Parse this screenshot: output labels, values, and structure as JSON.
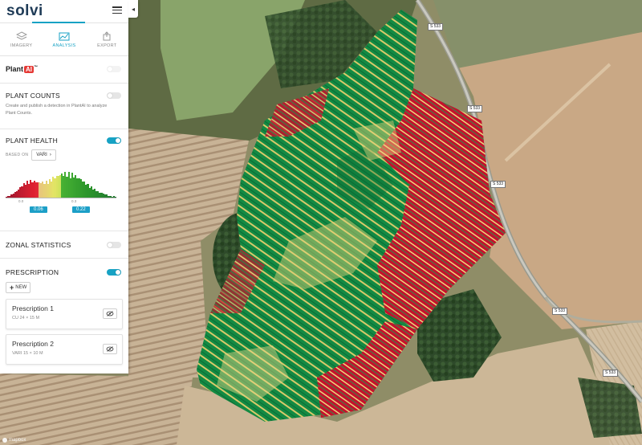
{
  "app": {
    "logo_text": "solvi",
    "accent_color": "#17a2c4"
  },
  "tabs": [
    {
      "label": "IMAGERY",
      "icon": "layers-icon",
      "active": false
    },
    {
      "label": "ANALYSIS",
      "icon": "analysis-chart-icon",
      "active": true
    },
    {
      "label": "EXPORT",
      "icon": "export-icon",
      "active": false
    }
  ],
  "plantai": {
    "title": "Plant",
    "badge": "AI",
    "trademark": "™"
  },
  "plant_counts": {
    "title": "PLANT COUNTS",
    "enabled": false,
    "description": "Create and publish a detection in PlantAI to analyze Plant Counts."
  },
  "plant_health": {
    "title": "PLANT HEALTH",
    "enabled": true,
    "based_on_label": "BASED ON",
    "index": "VARI",
    "axis_min": "0.0",
    "axis_mid": "0.3",
    "low_threshold": "0.06",
    "high_threshold": "0.22"
  },
  "zonal_statistics": {
    "title": "ZONAL STATISTICS",
    "enabled": false
  },
  "prescription": {
    "title": "PRESCRIPTION",
    "enabled": true,
    "new_label": "NEW",
    "items": [
      {
        "name": "Prescription 1",
        "detail": "CU 24 × 15 M"
      },
      {
        "name": "Prescription 2",
        "detail": "VARI 15 × 10 M"
      }
    ]
  },
  "map": {
    "road_labels": [
      "S 533",
      "S 533",
      "S 533",
      "S 533",
      "S 533"
    ],
    "attribution": "mapbox",
    "health_colors": {
      "low": "#c8102e",
      "mid": "#f3e28a",
      "high": "#0f7a3a"
    }
  }
}
